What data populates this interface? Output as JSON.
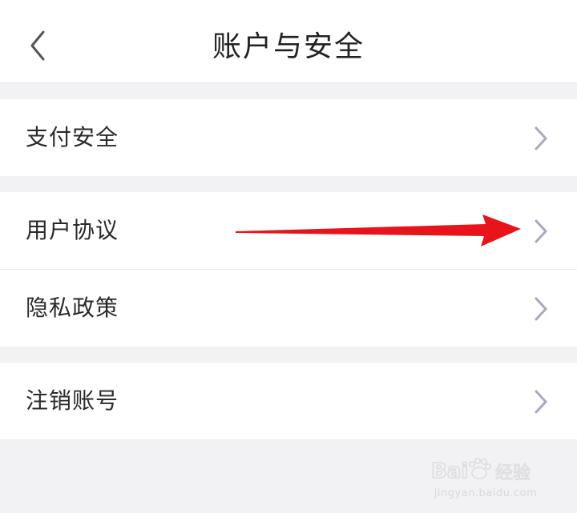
{
  "header": {
    "title": "账户与安全",
    "back_icon": "chevron-left-icon"
  },
  "menu": {
    "group_1": [
      {
        "label": "支付安全",
        "icon": "chevron-right-icon"
      }
    ],
    "group_2": [
      {
        "label": "用户协议",
        "icon": "chevron-right-icon"
      },
      {
        "label": "隐私政策",
        "icon": "chevron-right-icon"
      }
    ],
    "group_3": [
      {
        "label": "注销账号",
        "icon": "chevron-right-icon"
      }
    ]
  },
  "annotation": {
    "arrow_color": "#e8141c",
    "points_to": "用户协议"
  },
  "watermark": {
    "logo_text": "Bai度经验",
    "url": "jingyan.baidu.com"
  },
  "colors": {
    "background": "#f2f2f4",
    "surface": "#ffffff",
    "text": "#222222",
    "chevron": "#a8a8c0",
    "divider": "#e8e8ec"
  }
}
